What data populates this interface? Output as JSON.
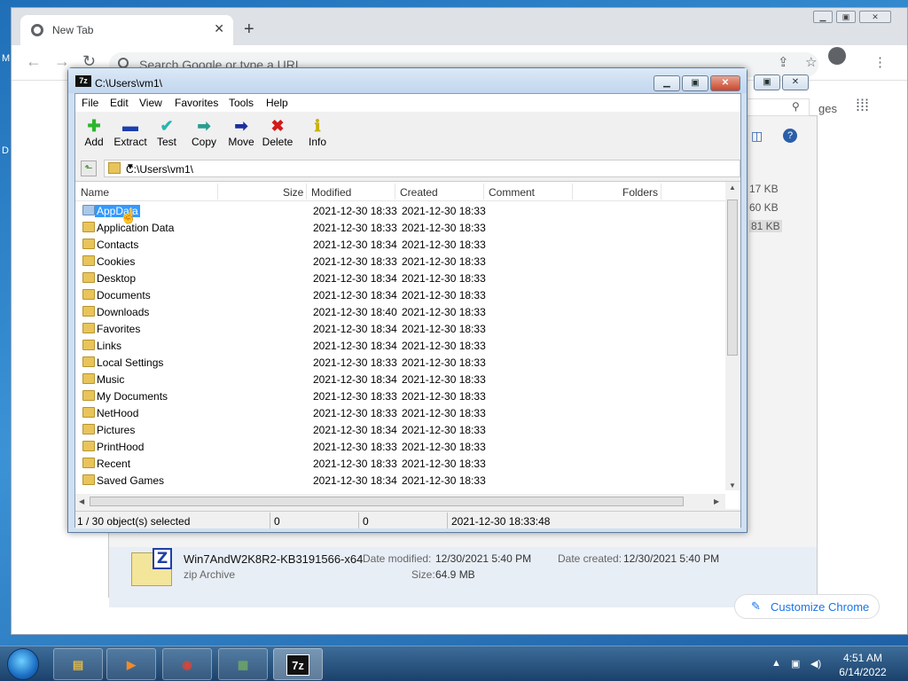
{
  "desktop": {
    "labels": [
      "M",
      "D"
    ]
  },
  "chrome": {
    "tab_title": "New Tab",
    "new_tab": "+",
    "omnibox_placeholder": "Search Google or type a URL",
    "side_snippets": [
      "ges",
      "17 KB",
      "60 KB",
      "81 KB"
    ],
    "download": {
      "name": "Win7AndW2K8R2-KB3191566-x64",
      "type": "zip Archive",
      "modified_label": "Date modified:",
      "modified_value": "12/30/2021 5:40 PM",
      "size_label": "Size:",
      "size_value": "64.9 MB",
      "created_label": "Date created:",
      "created_value": "12/30/2021 5:40 PM"
    },
    "customize_label": "Customize Chrome"
  },
  "sevenzip": {
    "title": "C:\\Users\\vm1\\",
    "logo": "7z",
    "menu": [
      "File",
      "Edit",
      "View",
      "Favorites",
      "Tools",
      "Help"
    ],
    "toolbar": [
      {
        "label": "Add",
        "icon": "plus-icon",
        "glyph": "✚",
        "color": "#2db52d"
      },
      {
        "label": "Extract",
        "icon": "minus-icon",
        "glyph": "▬",
        "color": "#1b3fae"
      },
      {
        "label": "Test",
        "icon": "check-icon",
        "glyph": "✔",
        "color": "#2bb5b0"
      },
      {
        "label": "Copy",
        "icon": "copy-arrow-icon",
        "glyph": "➡",
        "color": "#2a9d8f"
      },
      {
        "label": "Move",
        "icon": "move-arrow-icon",
        "glyph": "➡",
        "color": "#1b2f9e"
      },
      {
        "label": "Delete",
        "icon": "delete-x-icon",
        "glyph": "✖",
        "color": "#d21a1a"
      },
      {
        "label": "Info",
        "icon": "info-icon",
        "glyph": "ℹ",
        "color": "#c9b000"
      }
    ],
    "address": "C:\\Users\\vm1\\",
    "columns": [
      "Name",
      "Size",
      "Modified",
      "Created",
      "Comment",
      "Folders"
    ],
    "rows": [
      {
        "name": "AppData",
        "modified": "2021-12-30 18:33",
        "created": "2021-12-30 18:33",
        "selected": true
      },
      {
        "name": "Application Data",
        "modified": "2021-12-30 18:33",
        "created": "2021-12-30 18:33"
      },
      {
        "name": "Contacts",
        "modified": "2021-12-30 18:34",
        "created": "2021-12-30 18:33"
      },
      {
        "name": "Cookies",
        "modified": "2021-12-30 18:33",
        "created": "2021-12-30 18:33"
      },
      {
        "name": "Desktop",
        "modified": "2021-12-30 18:34",
        "created": "2021-12-30 18:33"
      },
      {
        "name": "Documents",
        "modified": "2021-12-30 18:34",
        "created": "2021-12-30 18:33"
      },
      {
        "name": "Downloads",
        "modified": "2021-12-30 18:40",
        "created": "2021-12-30 18:33"
      },
      {
        "name": "Favorites",
        "modified": "2021-12-30 18:34",
        "created": "2021-12-30 18:33"
      },
      {
        "name": "Links",
        "modified": "2021-12-30 18:34",
        "created": "2021-12-30 18:33"
      },
      {
        "name": "Local Settings",
        "modified": "2021-12-30 18:33",
        "created": "2021-12-30 18:33"
      },
      {
        "name": "Music",
        "modified": "2021-12-30 18:34",
        "created": "2021-12-30 18:33"
      },
      {
        "name": "My Documents",
        "modified": "2021-12-30 18:33",
        "created": "2021-12-30 18:33"
      },
      {
        "name": "NetHood",
        "modified": "2021-12-30 18:33",
        "created": "2021-12-30 18:33"
      },
      {
        "name": "Pictures",
        "modified": "2021-12-30 18:34",
        "created": "2021-12-30 18:33"
      },
      {
        "name": "PrintHood",
        "modified": "2021-12-30 18:33",
        "created": "2021-12-30 18:33"
      },
      {
        "name": "Recent",
        "modified": "2021-12-30 18:33",
        "created": "2021-12-30 18:33"
      },
      {
        "name": "Saved Games",
        "modified": "2021-12-30 18:34",
        "created": "2021-12-30 18:33"
      }
    ],
    "status": {
      "selection": "1 / 30 object(s) selected",
      "size": "0",
      "packed": "0",
      "datetime": "2021-12-30 18:33:48"
    }
  },
  "taskbar": {
    "apps": [
      {
        "name": "explorer-icon",
        "glyph": "▤",
        "color": "#e0b84a"
      },
      {
        "name": "media-player-icon",
        "glyph": "▶",
        "color": "#ef8b2c"
      },
      {
        "name": "chrome-icon",
        "glyph": "◉",
        "color": "#db4437"
      },
      {
        "name": "network-monitor-icon",
        "glyph": "▦",
        "color": "#6aa36a"
      },
      {
        "name": "sevenzip-icon",
        "glyph": "7z",
        "color": "#111111",
        "active": true
      }
    ],
    "time": "4:51 AM",
    "date": "6/14/2022"
  }
}
